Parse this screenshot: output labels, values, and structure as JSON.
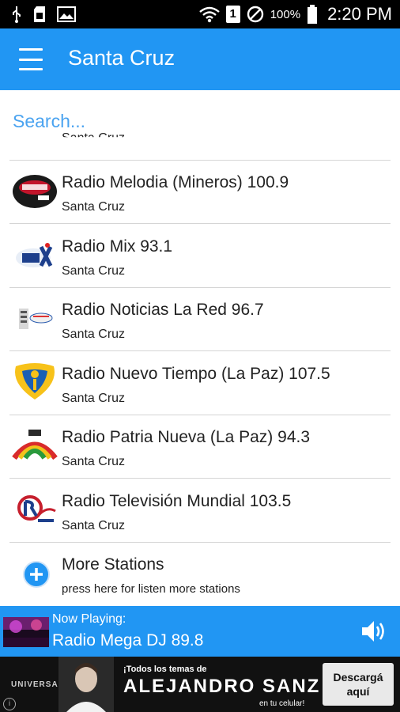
{
  "status_bar": {
    "icons_left": [
      "usb-icon",
      "sd-card-icon",
      "image-icon"
    ],
    "icons_right": [
      "wifi-icon",
      "sim-1-icon",
      "do-not-disturb-icon",
      "battery-icon"
    ],
    "sim_slot": "1",
    "battery": "100%",
    "time": "2:20 PM"
  },
  "app_bar": {
    "title": "Santa Cruz",
    "menu_icon": "hamburger-menu-icon",
    "color": "#2196f3"
  },
  "search": {
    "placeholder": "Search..."
  },
  "list": {
    "partial_item_subtitle": "Santa Cruz",
    "items": [
      {
        "title": "Radio Melodia (Mineros) 100.9",
        "subtitle": "Santa Cruz",
        "logo": "radio-melodia-logo"
      },
      {
        "title": "Radio Mix 93.1",
        "subtitle": "Santa Cruz",
        "logo": "radio-mix-logo"
      },
      {
        "title": "Radio Noticias La Red 96.7",
        "subtitle": "Santa Cruz",
        "logo": "radio-noticias-la-red-logo"
      },
      {
        "title": "Radio Nuevo Tiempo (La Paz) 107.5",
        "subtitle": "Santa Cruz",
        "logo": "radio-nuevo-tiempo-logo"
      },
      {
        "title": "Radio Patria Nueva (La Paz) 94.3",
        "subtitle": "Santa Cruz",
        "logo": "radio-patria-nueva-logo"
      },
      {
        "title": "Radio Televisión Mundial 103.5",
        "subtitle": "Santa Cruz",
        "logo": "radio-television-mundial-logo"
      }
    ],
    "more": {
      "title": "More Stations",
      "subtitle": "press here for listen more stations",
      "icon": "add-circle-icon"
    }
  },
  "now_playing": {
    "label": "Now Playing:",
    "station": "Radio Mega DJ 89.8",
    "icon": "volume-icon"
  },
  "ad": {
    "brand": "UNIVERSAL",
    "line1": "¡Todos los temas de",
    "headline": "ALEJANDRO SANZ",
    "line2": "en tu celular!",
    "cta": "Descargá aquí",
    "info": "i"
  }
}
